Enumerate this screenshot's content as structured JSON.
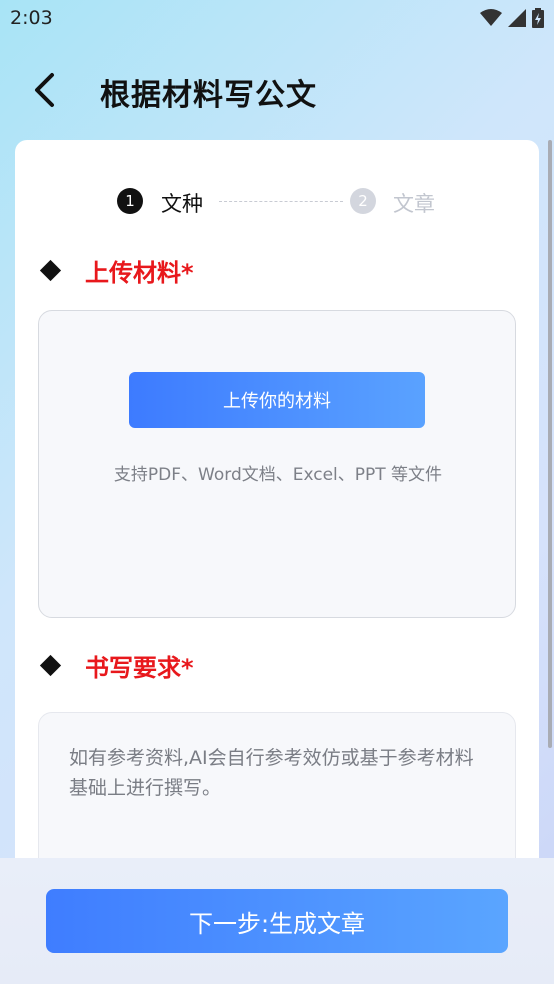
{
  "status_bar": {
    "time": "2:03"
  },
  "header": {
    "title": "根据材料写公文"
  },
  "stepper": {
    "step1": {
      "number": "1",
      "label": "文种"
    },
    "step2": {
      "number": "2",
      "label": "文章"
    }
  },
  "upload_section": {
    "label": "上传材料*",
    "button_label": "上传你的材料",
    "hint": "支持PDF、Word文档、Excel、PPT 等文件"
  },
  "requirements_section": {
    "label": "书写要求*",
    "placeholder": "如有参考资料,AI会自行参考效仿或基于参考材料基础上进行撰写。"
  },
  "footer": {
    "next_label": "下一步:生成文章"
  },
  "colors": {
    "accent": "#3f7dff",
    "required_label": "#e8181c"
  }
}
